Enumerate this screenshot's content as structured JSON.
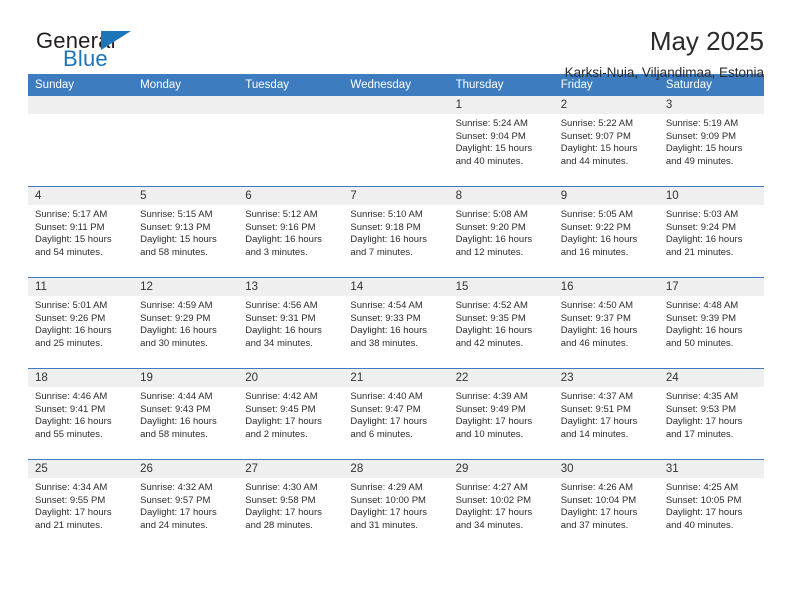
{
  "brand": {
    "name_part1": "General",
    "name_part2": "Blue",
    "flag_icon": "triangle-flag-icon"
  },
  "header": {
    "title": "May 2025",
    "subtitle": "Karksi-Nuia, Viljandimaa, Estonia"
  },
  "colors": {
    "header_blue": "#3c7cbf",
    "brand_blue": "#1b75bb",
    "daynum_gray": "#efefef",
    "text": "#2c2c2c"
  },
  "weekdays": [
    "Sunday",
    "Monday",
    "Tuesday",
    "Wednesday",
    "Thursday",
    "Friday",
    "Saturday"
  ],
  "weeks": [
    [
      {
        "empty": true
      },
      {
        "empty": true
      },
      {
        "empty": true
      },
      {
        "empty": true
      },
      {
        "day": "1",
        "sunrise": "Sunrise: 5:24 AM",
        "sunset": "Sunset: 9:04 PM",
        "daylight": "Daylight: 15 hours and 40 minutes."
      },
      {
        "day": "2",
        "sunrise": "Sunrise: 5:22 AM",
        "sunset": "Sunset: 9:07 PM",
        "daylight": "Daylight: 15 hours and 44 minutes."
      },
      {
        "day": "3",
        "sunrise": "Sunrise: 5:19 AM",
        "sunset": "Sunset: 9:09 PM",
        "daylight": "Daylight: 15 hours and 49 minutes."
      }
    ],
    [
      {
        "day": "4",
        "sunrise": "Sunrise: 5:17 AM",
        "sunset": "Sunset: 9:11 PM",
        "daylight": "Daylight: 15 hours and 54 minutes."
      },
      {
        "day": "5",
        "sunrise": "Sunrise: 5:15 AM",
        "sunset": "Sunset: 9:13 PM",
        "daylight": "Daylight: 15 hours and 58 minutes."
      },
      {
        "day": "6",
        "sunrise": "Sunrise: 5:12 AM",
        "sunset": "Sunset: 9:16 PM",
        "daylight": "Daylight: 16 hours and 3 minutes."
      },
      {
        "day": "7",
        "sunrise": "Sunrise: 5:10 AM",
        "sunset": "Sunset: 9:18 PM",
        "daylight": "Daylight: 16 hours and 7 minutes."
      },
      {
        "day": "8",
        "sunrise": "Sunrise: 5:08 AM",
        "sunset": "Sunset: 9:20 PM",
        "daylight": "Daylight: 16 hours and 12 minutes."
      },
      {
        "day": "9",
        "sunrise": "Sunrise: 5:05 AM",
        "sunset": "Sunset: 9:22 PM",
        "daylight": "Daylight: 16 hours and 16 minutes."
      },
      {
        "day": "10",
        "sunrise": "Sunrise: 5:03 AM",
        "sunset": "Sunset: 9:24 PM",
        "daylight": "Daylight: 16 hours and 21 minutes."
      }
    ],
    [
      {
        "day": "11",
        "sunrise": "Sunrise: 5:01 AM",
        "sunset": "Sunset: 9:26 PM",
        "daylight": "Daylight: 16 hours and 25 minutes."
      },
      {
        "day": "12",
        "sunrise": "Sunrise: 4:59 AM",
        "sunset": "Sunset: 9:29 PM",
        "daylight": "Daylight: 16 hours and 30 minutes."
      },
      {
        "day": "13",
        "sunrise": "Sunrise: 4:56 AM",
        "sunset": "Sunset: 9:31 PM",
        "daylight": "Daylight: 16 hours and 34 minutes."
      },
      {
        "day": "14",
        "sunrise": "Sunrise: 4:54 AM",
        "sunset": "Sunset: 9:33 PM",
        "daylight": "Daylight: 16 hours and 38 minutes."
      },
      {
        "day": "15",
        "sunrise": "Sunrise: 4:52 AM",
        "sunset": "Sunset: 9:35 PM",
        "daylight": "Daylight: 16 hours and 42 minutes."
      },
      {
        "day": "16",
        "sunrise": "Sunrise: 4:50 AM",
        "sunset": "Sunset: 9:37 PM",
        "daylight": "Daylight: 16 hours and 46 minutes."
      },
      {
        "day": "17",
        "sunrise": "Sunrise: 4:48 AM",
        "sunset": "Sunset: 9:39 PM",
        "daylight": "Daylight: 16 hours and 50 minutes."
      }
    ],
    [
      {
        "day": "18",
        "sunrise": "Sunrise: 4:46 AM",
        "sunset": "Sunset: 9:41 PM",
        "daylight": "Daylight: 16 hours and 55 minutes."
      },
      {
        "day": "19",
        "sunrise": "Sunrise: 4:44 AM",
        "sunset": "Sunset: 9:43 PM",
        "daylight": "Daylight: 16 hours and 58 minutes."
      },
      {
        "day": "20",
        "sunrise": "Sunrise: 4:42 AM",
        "sunset": "Sunset: 9:45 PM",
        "daylight": "Daylight: 17 hours and 2 minutes."
      },
      {
        "day": "21",
        "sunrise": "Sunrise: 4:40 AM",
        "sunset": "Sunset: 9:47 PM",
        "daylight": "Daylight: 17 hours and 6 minutes."
      },
      {
        "day": "22",
        "sunrise": "Sunrise: 4:39 AM",
        "sunset": "Sunset: 9:49 PM",
        "daylight": "Daylight: 17 hours and 10 minutes."
      },
      {
        "day": "23",
        "sunrise": "Sunrise: 4:37 AM",
        "sunset": "Sunset: 9:51 PM",
        "daylight": "Daylight: 17 hours and 14 minutes."
      },
      {
        "day": "24",
        "sunrise": "Sunrise: 4:35 AM",
        "sunset": "Sunset: 9:53 PM",
        "daylight": "Daylight: 17 hours and 17 minutes."
      }
    ],
    [
      {
        "day": "25",
        "sunrise": "Sunrise: 4:34 AM",
        "sunset": "Sunset: 9:55 PM",
        "daylight": "Daylight: 17 hours and 21 minutes."
      },
      {
        "day": "26",
        "sunrise": "Sunrise: 4:32 AM",
        "sunset": "Sunset: 9:57 PM",
        "daylight": "Daylight: 17 hours and 24 minutes."
      },
      {
        "day": "27",
        "sunrise": "Sunrise: 4:30 AM",
        "sunset": "Sunset: 9:58 PM",
        "daylight": "Daylight: 17 hours and 28 minutes."
      },
      {
        "day": "28",
        "sunrise": "Sunrise: 4:29 AM",
        "sunset": "Sunset: 10:00 PM",
        "daylight": "Daylight: 17 hours and 31 minutes."
      },
      {
        "day": "29",
        "sunrise": "Sunrise: 4:27 AM",
        "sunset": "Sunset: 10:02 PM",
        "daylight": "Daylight: 17 hours and 34 minutes."
      },
      {
        "day": "30",
        "sunrise": "Sunrise: 4:26 AM",
        "sunset": "Sunset: 10:04 PM",
        "daylight": "Daylight: 17 hours and 37 minutes."
      },
      {
        "day": "31",
        "sunrise": "Sunrise: 4:25 AM",
        "sunset": "Sunset: 10:05 PM",
        "daylight": "Daylight: 17 hours and 40 minutes."
      }
    ]
  ]
}
